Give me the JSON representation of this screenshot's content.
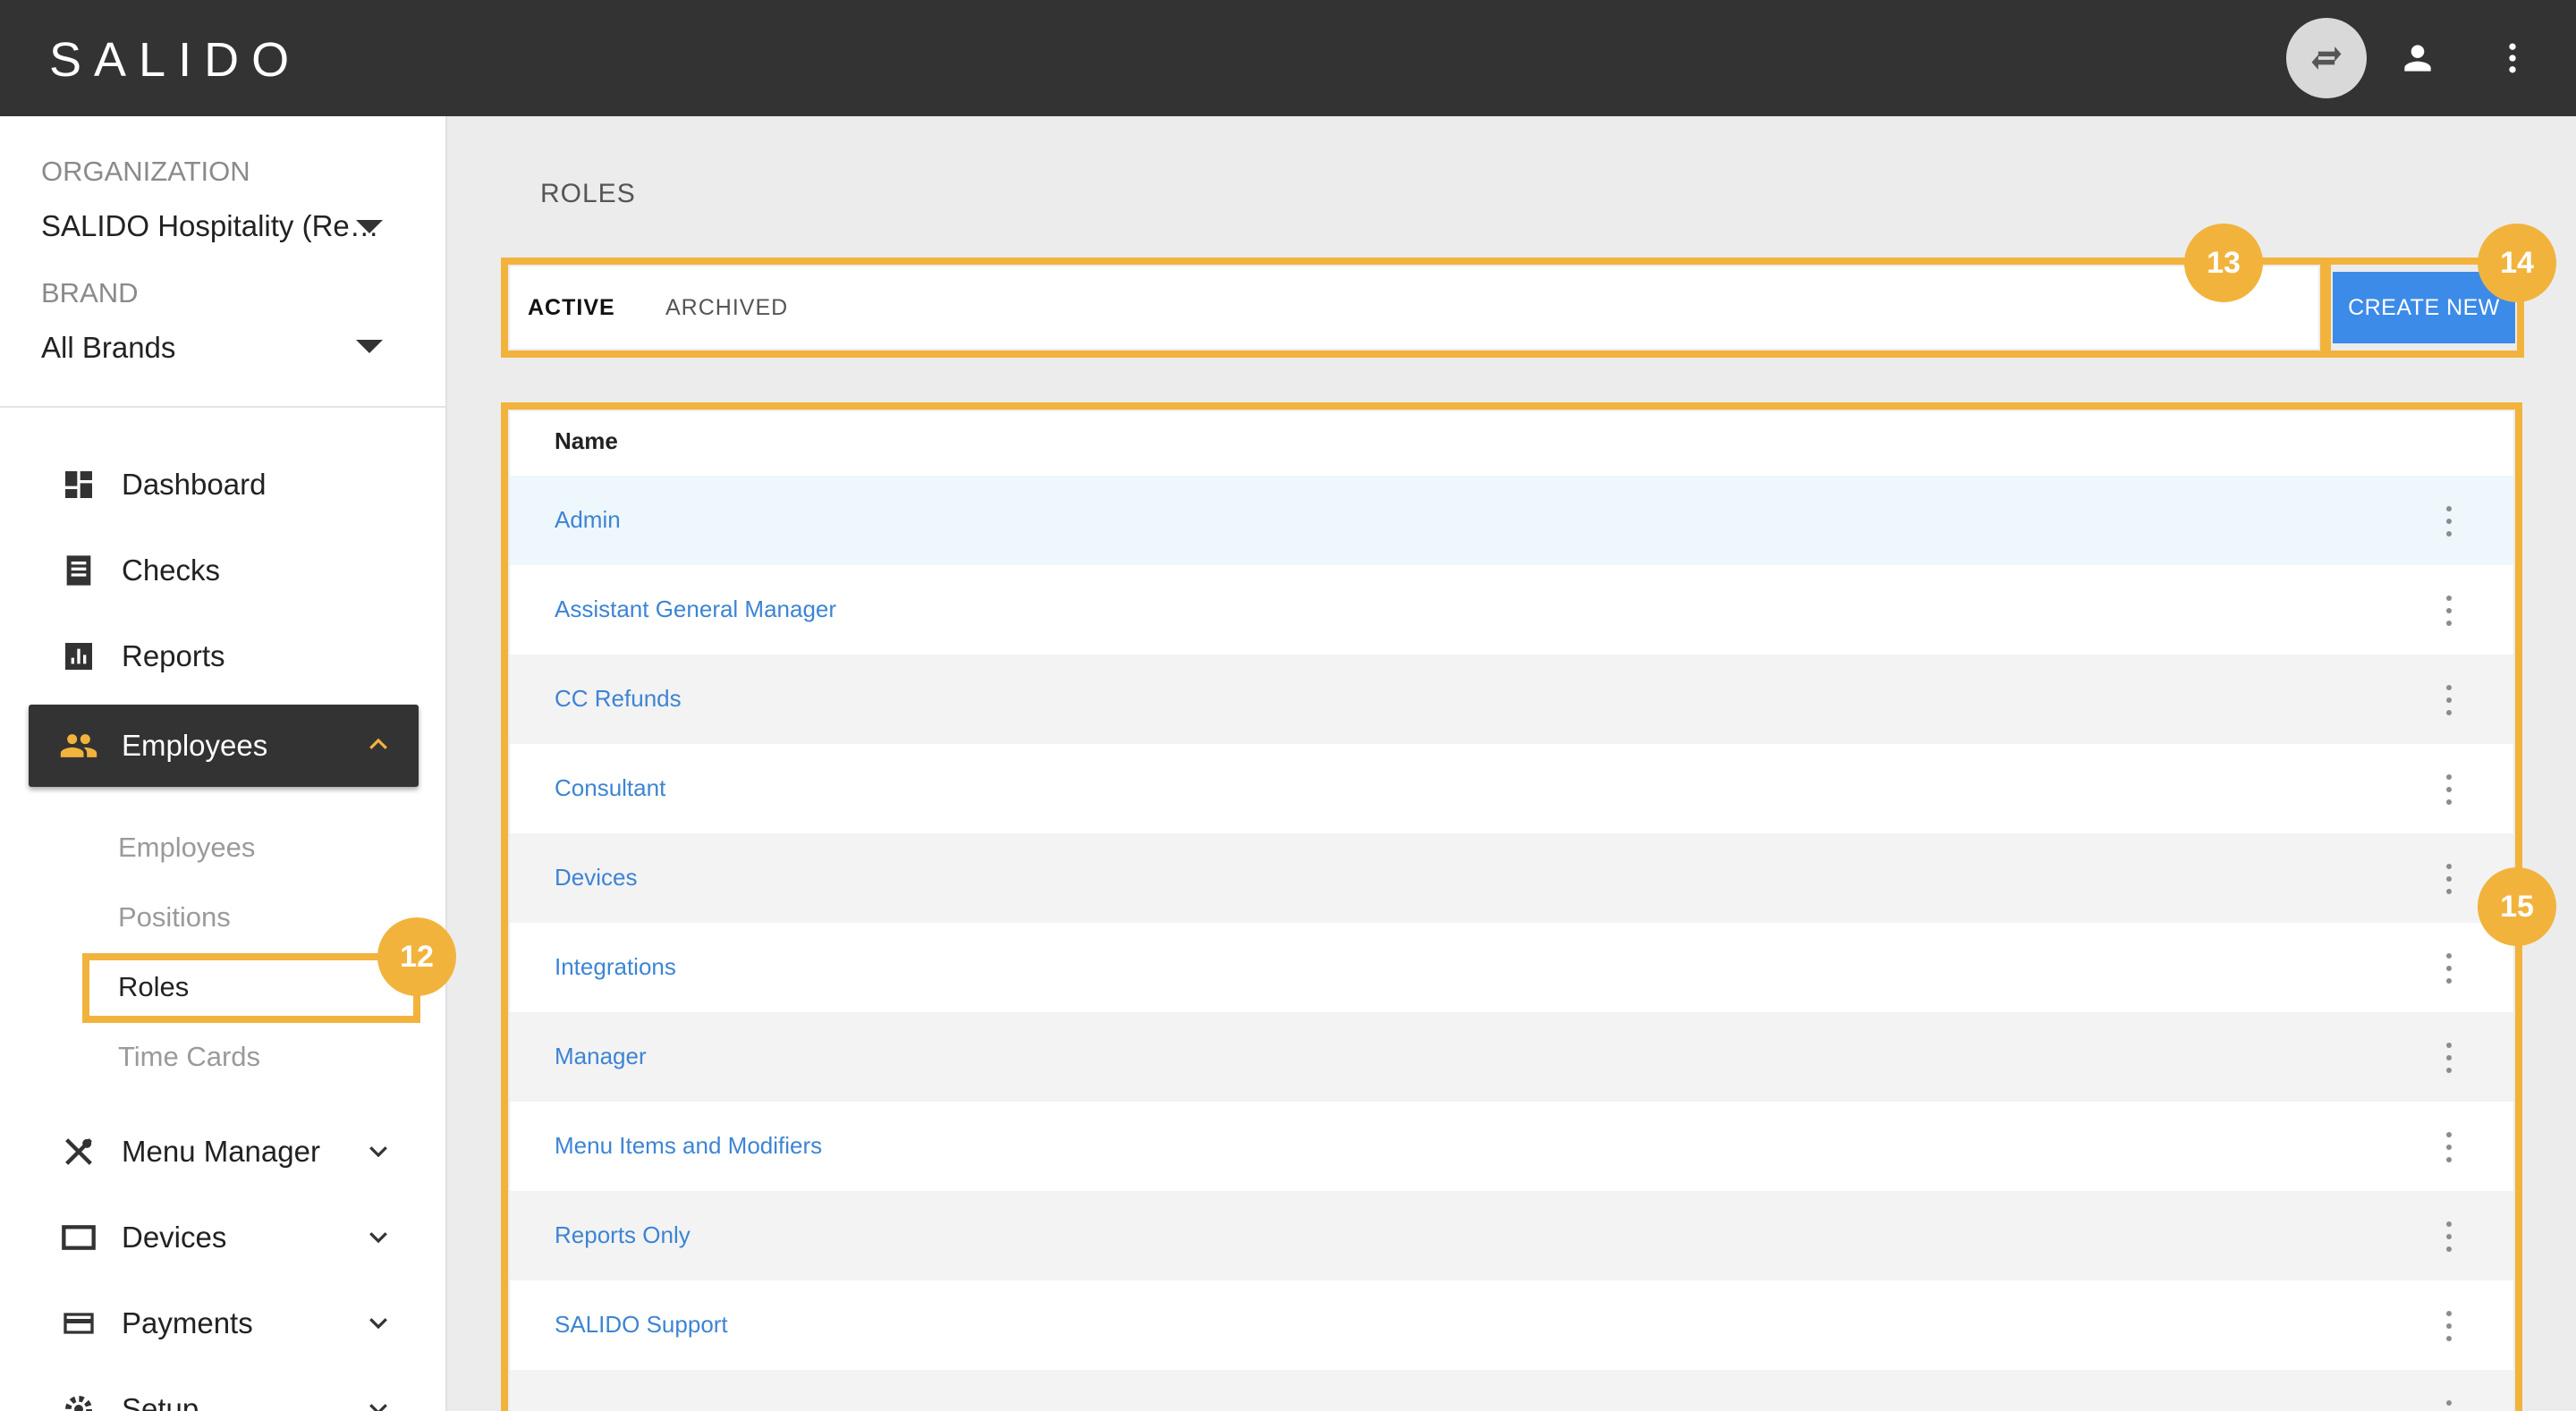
{
  "app": {
    "logo": "SALIDO"
  },
  "topbar": {
    "icons": [
      "swap-icon",
      "account-icon",
      "more-vert-icon"
    ]
  },
  "sidebar": {
    "org_label": "ORGANIZATION",
    "org_value": "SALIDO Hospitality (Re…",
    "brand_label": "BRAND",
    "brand_value": "All Brands",
    "nav": [
      {
        "label": "Dashboard",
        "icon": "dashboard-icon"
      },
      {
        "label": "Checks",
        "icon": "receipt-icon"
      },
      {
        "label": "Reports",
        "icon": "bar-chart-icon"
      },
      {
        "label": "Employees",
        "icon": "people-icon"
      },
      {
        "label": "Menu Manager",
        "icon": "utensils-icon"
      },
      {
        "label": "Devices",
        "icon": "tablet-icon"
      },
      {
        "label": "Payments",
        "icon": "credit-card-icon"
      },
      {
        "label": "Setup",
        "icon": "gear-icon"
      }
    ],
    "sub_items": [
      "Employees",
      "Positions",
      "Roles",
      "Time Cards"
    ]
  },
  "callouts": {
    "roles_nav": "12",
    "tabs": "13",
    "create": "14",
    "table": "15"
  },
  "main": {
    "title": "ROLES",
    "tabs": [
      "ACTIVE",
      "ARCHIVED"
    ],
    "create_label": "CREATE NEW",
    "table": {
      "column": "Name",
      "rows": [
        "Admin",
        "Assistant General Manager",
        "CC Refunds",
        "Consultant",
        "Devices",
        "Integrations",
        "Manager",
        "Menu Items and Modifiers",
        "Reports Only",
        "SALIDO Support"
      ]
    }
  },
  "colors": {
    "accent": "#f2b33d",
    "primary": "#3d8be8",
    "link": "#3d84d4",
    "topbar": "#333333"
  }
}
